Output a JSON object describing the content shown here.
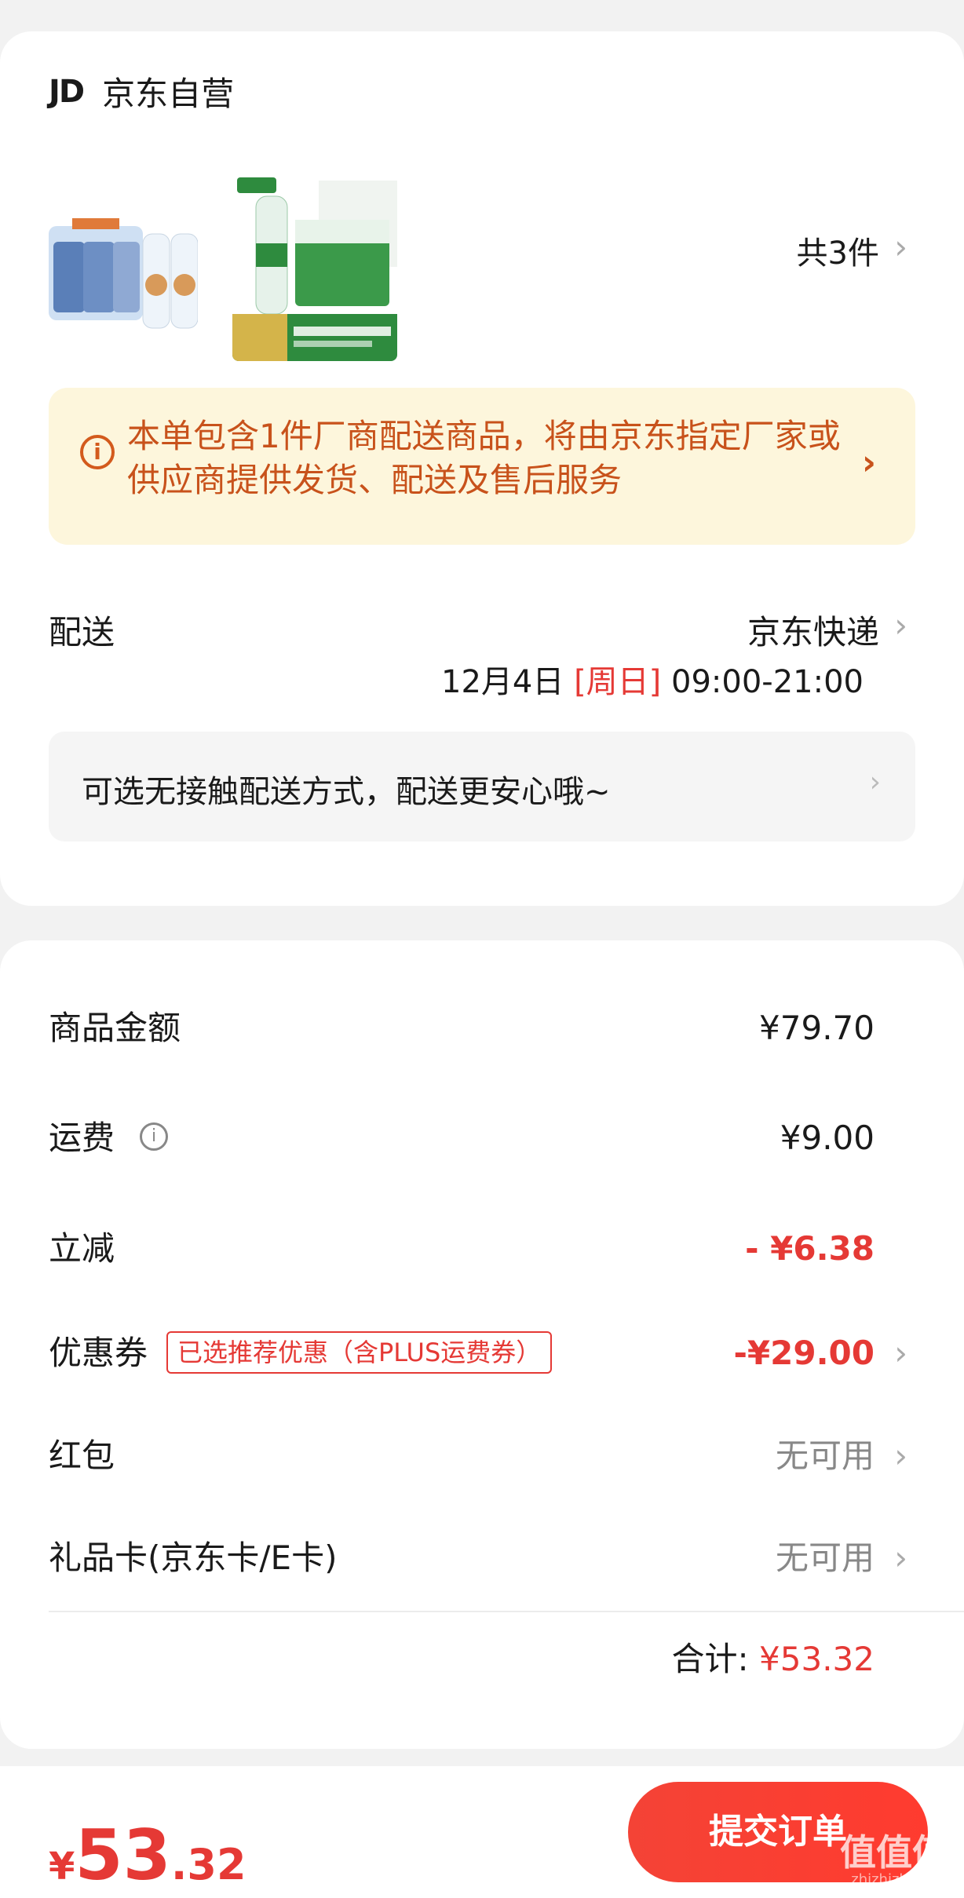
{
  "shop": {
    "logo": "JD",
    "name": "京东自营"
  },
  "products": {
    "count_label": "共3件"
  },
  "notice": {
    "text": "本单包含1件厂商配送商品，将由京东指定厂家或供应商提供发货、配送及售后服务"
  },
  "shipping": {
    "label": "配送",
    "method": "京东快递",
    "date": "12月4日",
    "day": "[周日]",
    "time_window": "09:00-21:00"
  },
  "contactless": {
    "text": "可选无接触配送方式，配送更安心哦~"
  },
  "summary": {
    "goods_label": "商品金额",
    "goods_value": "¥79.70",
    "freight_label": "运费",
    "freight_value": "¥9.00",
    "discount_label": "立减",
    "discount_value": "- ¥6.38",
    "coupon_label": "优惠券",
    "coupon_badge": "已选推荐优惠（含PLUS运费券）",
    "coupon_value": "-¥29.00",
    "redpacket_label": "红包",
    "redpacket_value": "无可用",
    "giftcard_label": "礼品卡(京东卡/E卡)",
    "giftcard_value": "无可用",
    "total_label": "合计:",
    "total_value": "¥53.32"
  },
  "bottom_bar": {
    "currency": "¥",
    "price_int": "53",
    "price_dec": ".32",
    "submit_label": "提交订单",
    "watermark": "值值值",
    "watermark_sub": "zhizhizhi.com"
  },
  "colors": {
    "accent": "#e53935",
    "notice_bg": "#fdf6dc",
    "notice_text": "#c8521b"
  }
}
